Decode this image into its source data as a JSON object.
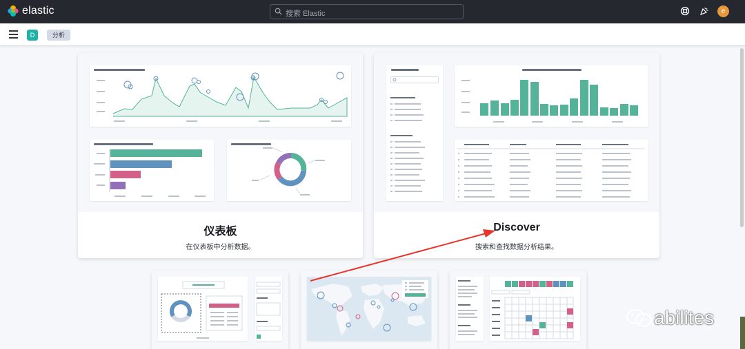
{
  "header": {
    "logo_text": "elastic",
    "search_placeholder": "搜索 Elastic",
    "icons": [
      "help-icon",
      "news-icon"
    ],
    "avatar_initial": "e"
  },
  "subbar": {
    "space_initial": "D",
    "breadcrumb": "分析"
  },
  "cards": [
    {
      "title": "仪表板",
      "description": "在仪表板中分析数据。"
    },
    {
      "title": "Discover",
      "description": "搜索和查找数据分析结果。"
    }
  ],
  "watermark": "abilites",
  "colors": {
    "topbar": "#25282f",
    "accent_green": "#54b399",
    "accent_blue": "#6092c0",
    "accent_pink": "#d36086",
    "accent_purple": "#9170b8",
    "arrow_red": "#e7352b"
  }
}
